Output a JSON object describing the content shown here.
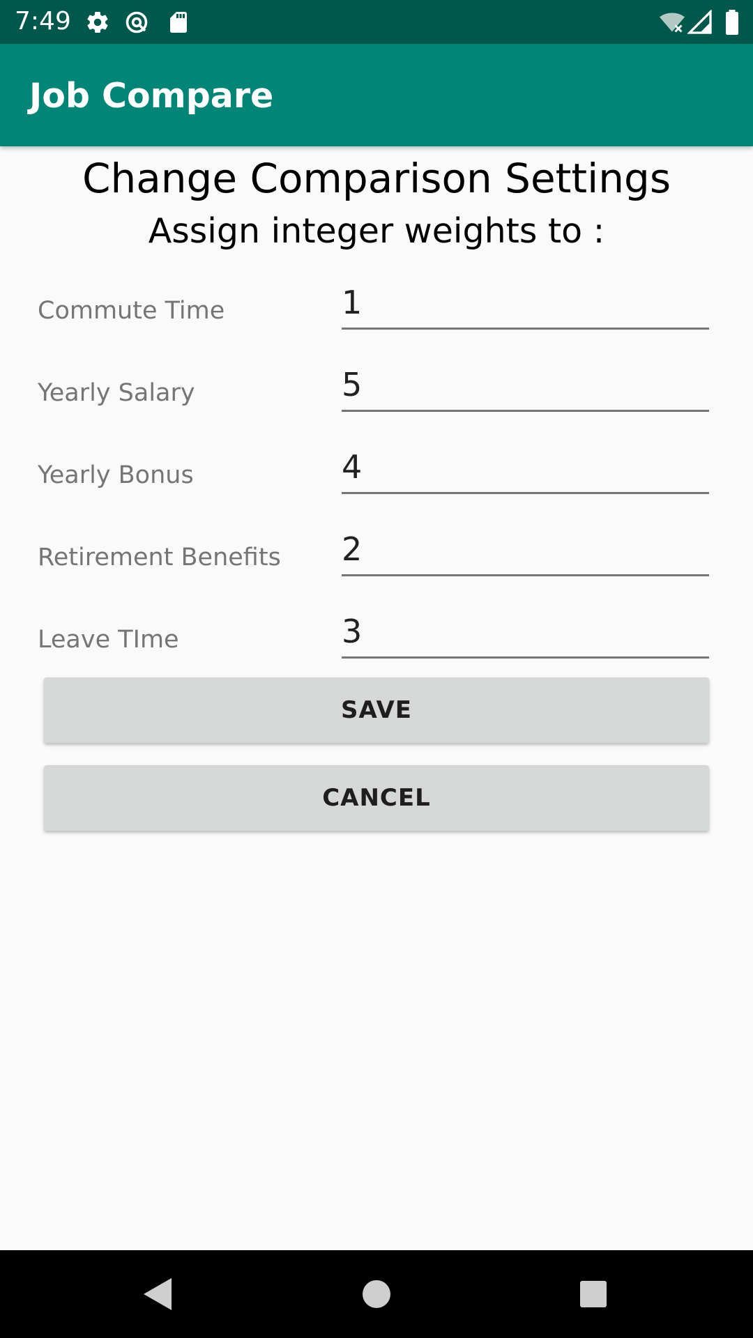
{
  "status_bar": {
    "time": "7:49",
    "left_icons": [
      "gear-icon",
      "vpn-key-icon",
      "sd-card-icon"
    ],
    "right_icons": [
      "wifi-off-icon",
      "cell-signal-icon",
      "battery-icon"
    ]
  },
  "app_bar": {
    "title": "Job Compare",
    "color": "#008577",
    "status_color": "#00574b"
  },
  "page": {
    "heading": "Change Comparison Settings",
    "subheading": "Assign integer weights to :"
  },
  "fields": [
    {
      "label": "Commute Time",
      "value": "1"
    },
    {
      "label": "Yearly Salary",
      "value": "5"
    },
    {
      "label": "Yearly Bonus",
      "value": "4"
    },
    {
      "label": "Retirement Benefits",
      "value": "2"
    },
    {
      "label": "Leave TIme",
      "value": "3"
    }
  ],
  "buttons": {
    "save": "SAVE",
    "cancel": "CANCEL"
  },
  "nav_bar": {
    "icons": [
      "back-icon",
      "home-icon",
      "recents-icon"
    ]
  }
}
